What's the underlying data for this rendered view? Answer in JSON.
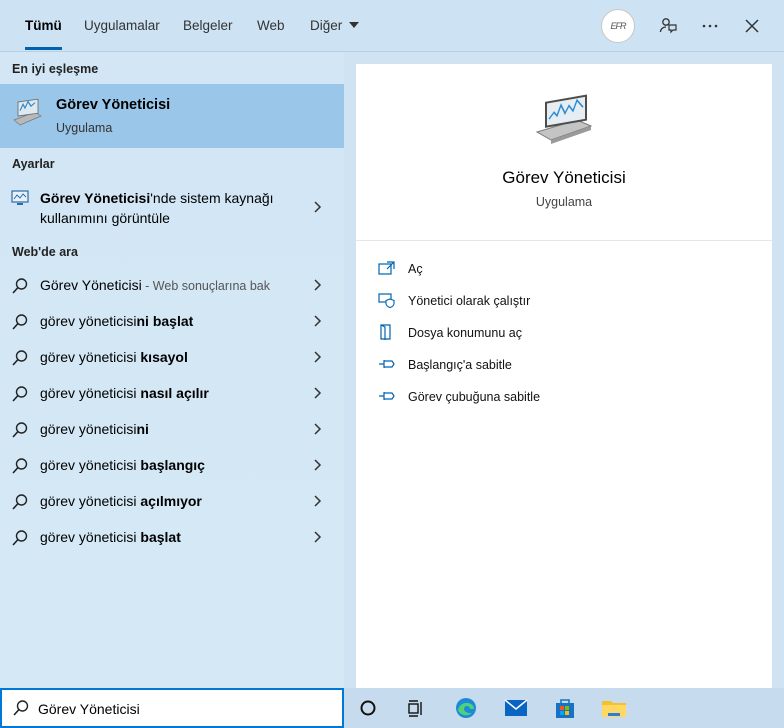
{
  "tabs": [
    {
      "label": "Tümü"
    },
    {
      "label": "Uygulamalar"
    },
    {
      "label": "Belgeler"
    },
    {
      "label": "Web"
    },
    {
      "label": "Diğer"
    }
  ],
  "header": {
    "avatar_text": "EFR",
    "icons": [
      "feedback-icon",
      "more-icon",
      "close-icon"
    ]
  },
  "left": {
    "best_match_heading": "En iyi eşleşme",
    "best_match": {
      "title": "Görev Yöneticisi",
      "subtitle": "Uygulama"
    },
    "settings_heading": "Ayarlar",
    "setting": {
      "bold": "Görev Yöneticisi",
      "rest": "'nde sistem kaynağı kullanımını görüntüle"
    },
    "web_heading": "Web'de ara",
    "web_results": [
      {
        "plain": "Görev Yöneticisi",
        "bold": "",
        "hint": " - Web sonuçlarına bak"
      },
      {
        "plain": "görev yöneticisi",
        "bold": "ni başlat",
        "hint": ""
      },
      {
        "plain": "görev yöneticisi ",
        "bold": "kısayol",
        "hint": ""
      },
      {
        "plain": "görev yöneticisi ",
        "bold": "nasıl açılır",
        "hint": ""
      },
      {
        "plain": "görev yöneticisi",
        "bold": "ni",
        "hint": ""
      },
      {
        "plain": "görev yöneticisi ",
        "bold": "başlangıç",
        "hint": ""
      },
      {
        "plain": "görev yöneticisi ",
        "bold": "açılmıyor",
        "hint": ""
      },
      {
        "plain": "görev yöneticisi ",
        "bold": "başlat",
        "hint": ""
      }
    ]
  },
  "right": {
    "title": "Görev Yöneticisi",
    "subtitle": "Uygulama",
    "actions": [
      {
        "label": "Aç",
        "icon": "open-icon"
      },
      {
        "label": "Yönetici olarak çalıştır",
        "icon": "shield-icon"
      },
      {
        "label": "Dosya konumunu aç",
        "icon": "file-location-icon"
      },
      {
        "label": "Başlangıç'a sabitle",
        "icon": "pin-icon"
      },
      {
        "label": "Görev çubuğuna sabitle",
        "icon": "pin-icon"
      }
    ]
  },
  "search": {
    "value": "Görev Yöneticisi"
  },
  "taskbar": {
    "icons": [
      "cortana-icon",
      "task-view-icon",
      "edge-icon",
      "mail-icon",
      "store-icon",
      "file-explorer-icon"
    ]
  },
  "colors": {
    "accent": "#0063b1",
    "selected": "#99c6e9",
    "panel": "#d2e6f5"
  }
}
